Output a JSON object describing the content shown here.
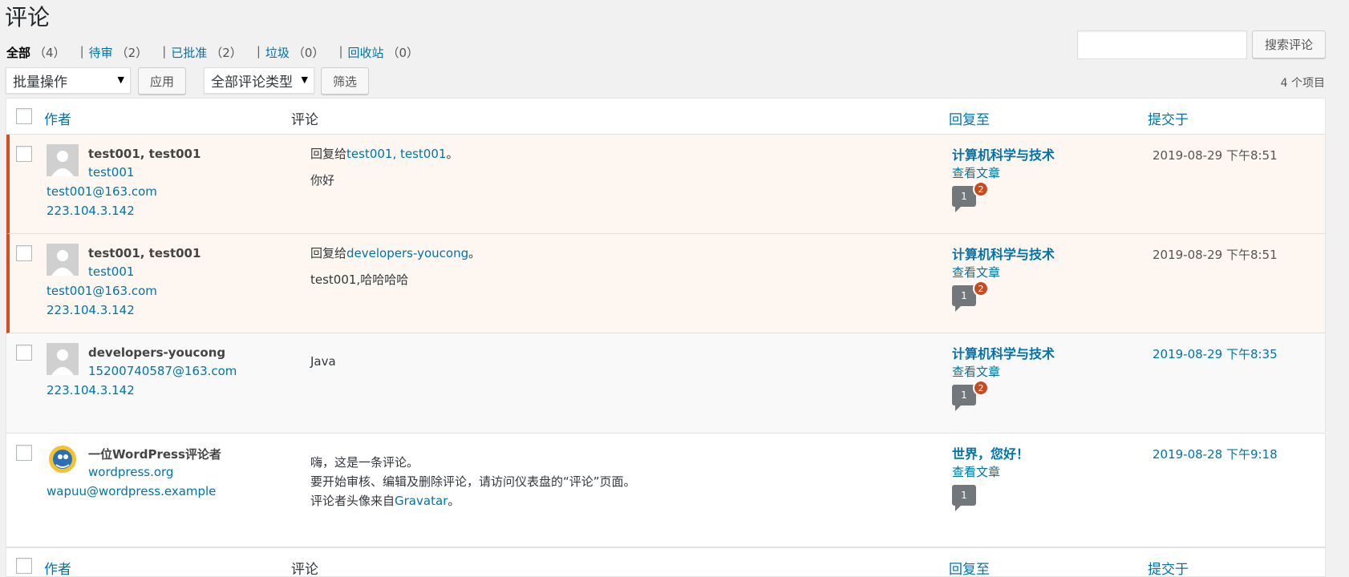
{
  "page": {
    "title": "评论"
  },
  "filters": [
    {
      "label": "全部",
      "count": "（4）",
      "current": true
    },
    {
      "label": "待审",
      "count": "（2）"
    },
    {
      "label": "已批准",
      "count": "（2）"
    },
    {
      "label": "垃圾",
      "count": "（0）"
    },
    {
      "label": "回收站",
      "count": "（0）"
    }
  ],
  "filter_separator": "|",
  "search": {
    "button": "搜索评论",
    "value": ""
  },
  "toolbar": {
    "bulk_action": "批量操作",
    "apply": "应用",
    "comment_type": "全部评论类型",
    "filter": "筛选",
    "items_count": "4 个项目"
  },
  "columns": {
    "author": "作者",
    "comment": "评论",
    "response": "回复至",
    "submitted": "提交于"
  },
  "comments": [
    {
      "author_name": "test001, test001",
      "author_url": "test001",
      "author_email": "test001@163.com",
      "author_ip": "223.104.3.142",
      "reply_prefix": "回复给",
      "reply_to": "test001, test001",
      "reply_suffix": "。",
      "text": "你好",
      "post_title": "计算机科学与技术",
      "view_post": "查看文章",
      "approved_count": "1",
      "pending_count": "2",
      "date": "2019-08-29 下午8:51",
      "status": "pending"
    },
    {
      "author_name": "test001, test001",
      "author_url": "test001",
      "author_email": "test001@163.com",
      "author_ip": "223.104.3.142",
      "reply_prefix": "回复给",
      "reply_to": "developers-youcong",
      "reply_suffix": "。",
      "text": "test001,哈哈哈哈",
      "post_title": "计算机科学与技术",
      "view_post": "查看文章",
      "approved_count": "1",
      "pending_count": "2",
      "date": "2019-08-29 下午8:51",
      "status": "pending"
    },
    {
      "author_name": "developers-youcong",
      "author_email": "15200740587@163.com",
      "author_ip": "223.104.3.142",
      "text": "Java",
      "post_title": "计算机科学与技术",
      "view_post": "查看文章",
      "approved_count": "1",
      "pending_count": "2",
      "date": "2019-08-29 下午8:35",
      "status": "approved"
    },
    {
      "author_name": "一位WordPress评论者",
      "author_url": "wordpress.org",
      "author_email": "wapuu@wordpress.example",
      "text_line1": "嗨，这是一条评论。",
      "text_line2": "要开始审核、编辑及删除评论，请访问仪表盘的“评论”页面。",
      "text_line3_prefix": "评论者头像来自",
      "text_line3_link": "Gravatar",
      "text_line3_suffix": "。",
      "post_title": "世界，您好！",
      "view_post": "查看文章",
      "approved_count": "1",
      "date": "2019-08-28 下午9:18",
      "status": "approved"
    }
  ],
  "colors": {
    "link": "#0073aa",
    "pending_border": "#d54e21",
    "pending_badge": "#ca4a1f"
  }
}
